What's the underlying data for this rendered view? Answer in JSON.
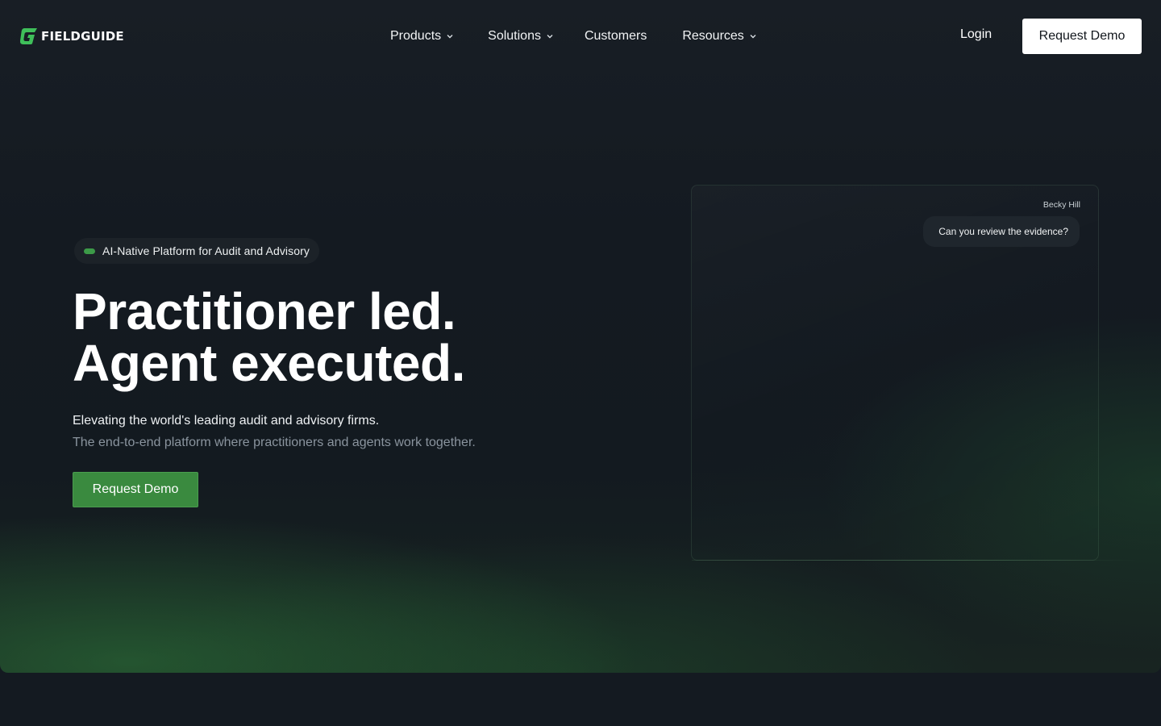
{
  "brand": {
    "name": "FIELDGUIDE",
    "logo_icon": "fieldguide-g-logo",
    "accent_color": "#3a8a3f",
    "accent_light": "#3c9a48"
  },
  "nav": {
    "items": [
      {
        "label": "Products",
        "has_dropdown": true
      },
      {
        "label": "Solutions",
        "has_dropdown": true
      },
      {
        "label": "Customers",
        "has_dropdown": false
      },
      {
        "label": "Resources",
        "has_dropdown": true
      }
    ],
    "login_label": "Login",
    "cta_label": "Request Demo"
  },
  "hero": {
    "badge": "AI-Native Platform for Audit and Advisory",
    "headline_line1": "Practitioner led.",
    "headline_line2": "Agent executed.",
    "subtitle_primary": "Elevating the world's leading audit and advisory firms.",
    "subtitle_secondary": "The end-to-end platform where practitioners and agents work together.",
    "cta_label": "Request Demo"
  },
  "chat": {
    "author": "Becky Hill",
    "message": "Can you review the evidence?"
  }
}
